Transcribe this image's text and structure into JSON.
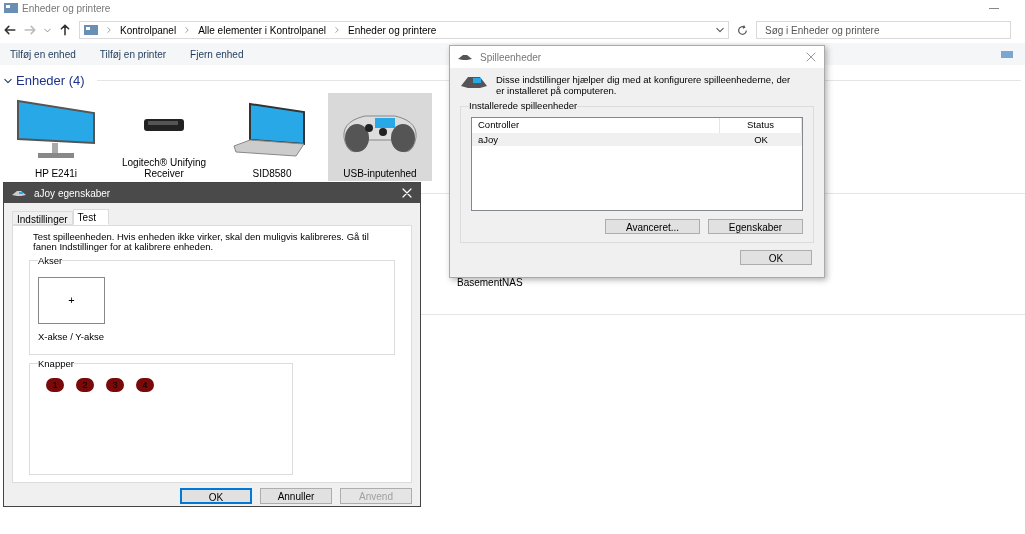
{
  "explorer": {
    "title": "Enheder og printere",
    "breadcrumb": [
      "Kontrolpanel",
      "Alle elementer i Kontrolpanel",
      "Enheder og printere"
    ],
    "search": {
      "placeholder": "Søg i Enheder og printere"
    },
    "toolbar": [
      "Tilføj en enhed",
      "Tilføj en printer",
      "Fjern enhed"
    ],
    "group": {
      "title": "Enheder (4)",
      "expanded": true
    },
    "devices": [
      {
        "name": "HP E241i",
        "kind": "monitor",
        "selected": false
      },
      {
        "name": "Logitech® Unifying Receiver",
        "kind": "receiver",
        "selected": false
      },
      {
        "name": "SID8580",
        "kind": "laptop",
        "selected": false
      },
      {
        "name": "USB-inputenhed",
        "kind": "gamepad",
        "selected": true
      }
    ],
    "other_devices": [
      {
        "name": "BasementNAS"
      }
    ]
  },
  "game_controllers": {
    "title": "Spilleenheder",
    "intro": "Disse indstillinger hjælper dig med at konfigurere spilleenhederne, der er installeret på computeren.",
    "group_title": "Installerede spilleenheder",
    "columns": [
      "Controller",
      "Status"
    ],
    "rows": [
      {
        "controller": "aJoy",
        "status": "OK",
        "selected": true
      }
    ],
    "buttons": [
      "Avanceret...",
      "Egenskaber"
    ],
    "ok": "OK"
  },
  "properties": {
    "title": "aJoy egenskaber",
    "tabs": [
      {
        "label": "Indstillinger",
        "selected": false
      },
      {
        "label": "Test",
        "selected": true
      }
    ],
    "intro": "Test spilleenheden. Hvis enheden ikke virker, skal den muligvis kalibreres. Gå til fanen Indstillinger for at kalibrere enheden.",
    "axes": {
      "title": "Akser",
      "label": "X-akse / Y-akse",
      "marker": "+"
    },
    "buttons_group": {
      "title": "Knapper",
      "buttons": [
        {
          "label": "1",
          "pressed": false
        },
        {
          "label": "2",
          "pressed": false
        },
        {
          "label": "3",
          "pressed": false
        },
        {
          "label": "4",
          "pressed": false
        }
      ]
    },
    "footer": [
      {
        "label": "OK",
        "kind": "default",
        "disabled": false
      },
      {
        "label": "Annuller",
        "kind": "normal",
        "disabled": false
      },
      {
        "label": "Anvend",
        "kind": "normal",
        "disabled": true
      }
    ]
  }
}
